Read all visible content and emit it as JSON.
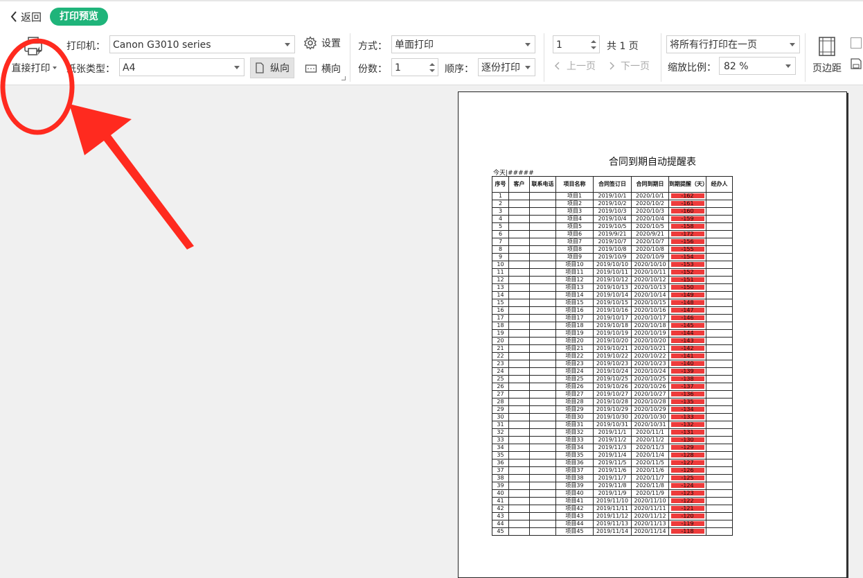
{
  "nav": {
    "back_label": "返回",
    "title": "打印预览"
  },
  "toolbar": {
    "direct_print": "直接打印",
    "printer_label": "打印机：",
    "printer_value": "Canon G3010 series",
    "settings_label": "设置",
    "paper_label": "纸张类型：",
    "paper_value": "A4",
    "portrait_label": "纵向",
    "landscape_label": "横向",
    "mode_label": "方式：",
    "mode_value": "单面打印",
    "copies_label": "份数：",
    "copies_value": "1",
    "order_label": "顺序：",
    "order_value": "逐份打印",
    "page_value": "1",
    "total_pages": "共 1 页",
    "prev_page": "上一页",
    "next_page": "下一页",
    "fit_value": "将所有行打印在一页",
    "zoom_label": "缩放比例：",
    "zoom_value": "82 %",
    "margins_label": "页边距"
  },
  "sheet": {
    "title": "合同到期自动提醒表",
    "today": "今天|#####",
    "headers": [
      "序号",
      "客户",
      "联系电话",
      "项目名称",
      "合同签订日",
      "合同到期日",
      "到期提醒（天）",
      "经办人"
    ],
    "rows": [
      [
        "1",
        "",
        "",
        "项目1",
        "2019/10/1",
        "2020/10/1",
        "-162",
        ""
      ],
      [
        "2",
        "",
        "",
        "项目2",
        "2019/10/2",
        "2020/10/2",
        "-161",
        ""
      ],
      [
        "3",
        "",
        "",
        "项目3",
        "2019/10/3",
        "2020/10/3",
        "-160",
        ""
      ],
      [
        "4",
        "",
        "",
        "项目4",
        "2019/10/4",
        "2020/10/4",
        "-159",
        ""
      ],
      [
        "5",
        "",
        "",
        "项目5",
        "2019/10/5",
        "2020/10/5",
        "-158",
        ""
      ],
      [
        "6",
        "",
        "",
        "项目6",
        "2019/9/21",
        "2020/9/21",
        "-172",
        ""
      ],
      [
        "7",
        "",
        "",
        "项目7",
        "2019/10/7",
        "2020/10/7",
        "-156",
        ""
      ],
      [
        "8",
        "",
        "",
        "项目8",
        "2019/10/8",
        "2020/10/8",
        "-155",
        ""
      ],
      [
        "9",
        "",
        "",
        "项目9",
        "2019/10/9",
        "2020/10/9",
        "-154",
        ""
      ],
      [
        "10",
        "",
        "",
        "项目10",
        "2019/10/10",
        "2020/10/10",
        "-153",
        ""
      ],
      [
        "11",
        "",
        "",
        "项目11",
        "2019/10/11",
        "2020/10/11",
        "-152",
        ""
      ],
      [
        "12",
        "",
        "",
        "项目12",
        "2019/10/12",
        "2020/10/12",
        "-151",
        ""
      ],
      [
        "13",
        "",
        "",
        "项目13",
        "2019/10/13",
        "2020/10/13",
        "-150",
        ""
      ],
      [
        "14",
        "",
        "",
        "项目14",
        "2019/10/14",
        "2020/10/14",
        "-149",
        ""
      ],
      [
        "15",
        "",
        "",
        "项目15",
        "2019/10/15",
        "2020/10/15",
        "-148",
        ""
      ],
      [
        "16",
        "",
        "",
        "项目16",
        "2019/10/16",
        "2020/10/16",
        "-147",
        ""
      ],
      [
        "17",
        "",
        "",
        "项目17",
        "2019/10/17",
        "2020/10/17",
        "-146",
        ""
      ],
      [
        "18",
        "",
        "",
        "项目18",
        "2019/10/18",
        "2020/10/18",
        "-145",
        ""
      ],
      [
        "19",
        "",
        "",
        "项目19",
        "2019/10/19",
        "2020/10/19",
        "-144",
        ""
      ],
      [
        "20",
        "",
        "",
        "项目20",
        "2019/10/20",
        "2020/10/20",
        "-143",
        ""
      ],
      [
        "21",
        "",
        "",
        "项目21",
        "2019/10/21",
        "2020/10/21",
        "-142",
        ""
      ],
      [
        "22",
        "",
        "",
        "项目22",
        "2019/10/22",
        "2020/10/22",
        "-141",
        ""
      ],
      [
        "23",
        "",
        "",
        "项目23",
        "2019/10/23",
        "2020/10/23",
        "-140",
        ""
      ],
      [
        "24",
        "",
        "",
        "项目24",
        "2019/10/24",
        "2020/10/24",
        "-139",
        ""
      ],
      [
        "25",
        "",
        "",
        "项目25",
        "2019/10/25",
        "2020/10/25",
        "-138",
        ""
      ],
      [
        "26",
        "",
        "",
        "项目26",
        "2019/10/26",
        "2020/10/26",
        "-137",
        ""
      ],
      [
        "27",
        "",
        "",
        "项目27",
        "2019/10/27",
        "2020/10/27",
        "-136",
        ""
      ],
      [
        "28",
        "",
        "",
        "项目28",
        "2019/10/28",
        "2020/10/28",
        "-135",
        ""
      ],
      [
        "29",
        "",
        "",
        "项目29",
        "2019/10/29",
        "2020/10/29",
        "-134",
        ""
      ],
      [
        "30",
        "",
        "",
        "项目30",
        "2019/10/30",
        "2020/10/30",
        "-133",
        ""
      ],
      [
        "31",
        "",
        "",
        "项目31",
        "2019/10/31",
        "2020/10/31",
        "-132",
        ""
      ],
      [
        "32",
        "",
        "",
        "项目32",
        "2019/11/1",
        "2020/11/1",
        "-131",
        ""
      ],
      [
        "33",
        "",
        "",
        "项目33",
        "2019/11/2",
        "2020/11/2",
        "-130",
        ""
      ],
      [
        "34",
        "",
        "",
        "项目34",
        "2019/11/3",
        "2020/11/3",
        "-129",
        ""
      ],
      [
        "35",
        "",
        "",
        "项目35",
        "2019/11/4",
        "2020/11/4",
        "-128",
        ""
      ],
      [
        "36",
        "",
        "",
        "项目36",
        "2019/11/5",
        "2020/11/5",
        "-127",
        ""
      ],
      [
        "37",
        "",
        "",
        "项目37",
        "2019/11/6",
        "2020/11/6",
        "-126",
        ""
      ],
      [
        "38",
        "",
        "",
        "项目38",
        "2019/11/7",
        "2020/11/7",
        "-125",
        ""
      ],
      [
        "39",
        "",
        "",
        "项目39",
        "2019/11/8",
        "2020/11/8",
        "-124",
        ""
      ],
      [
        "40",
        "",
        "",
        "项目40",
        "2019/11/9",
        "2020/11/9",
        "-123",
        ""
      ],
      [
        "41",
        "",
        "",
        "项目41",
        "2019/11/10",
        "2020/11/10",
        "-122",
        ""
      ],
      [
        "42",
        "",
        "",
        "项目42",
        "2019/11/11",
        "2020/11/11",
        "-121",
        ""
      ],
      [
        "43",
        "",
        "",
        "项目43",
        "2019/11/12",
        "2020/11/12",
        "-120",
        ""
      ],
      [
        "44",
        "",
        "",
        "项目44",
        "2019/11/13",
        "2020/11/13",
        "-119",
        ""
      ],
      [
        "45",
        "",
        "",
        "项目45",
        "2019/11/14",
        "2020/11/14",
        "-118",
        ""
      ]
    ]
  },
  "colors": {
    "accent": "#1fb47a",
    "alert_bar": "#ee3b3b",
    "annotation": "#ff2a1f"
  },
  "icons": {
    "printer": "printer-icon",
    "gear": "gear-icon",
    "back": "chevron-left-icon",
    "margins": "page-margins-icon"
  }
}
